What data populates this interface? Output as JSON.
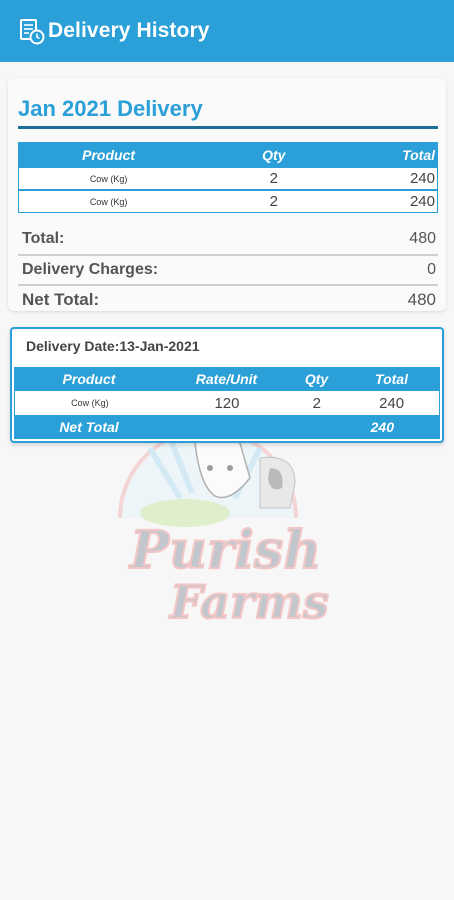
{
  "app_bar": {
    "title": "Delivery History",
    "icon": "delivery-clock-icon"
  },
  "colors": {
    "primary": "#2b9fd8",
    "accent_line": "#1e6f96"
  },
  "monthly_summary": {
    "title": "Jan 2021 Delivery",
    "columns": [
      "Product",
      "Qty",
      "Total"
    ],
    "rows": [
      {
        "product": "Cow (Kg)",
        "qty": "2",
        "total": "240"
      },
      {
        "product": "Cow (Kg)",
        "qty": "2",
        "total": "240"
      }
    ],
    "total_label": "Total:",
    "total_value": "480",
    "charges_label": "Delivery Charges:",
    "charges_value": "0",
    "net_label": "Net Total:",
    "net_value": "480"
  },
  "delivery": {
    "date_label": "Delivery Date:13-Jan-2021",
    "columns": [
      "Product",
      "Rate/Unit",
      "Qty",
      "Total"
    ],
    "rows": [
      {
        "product": "Cow (Kg)",
        "rate": "120",
        "qty": "2",
        "total": "240"
      }
    ],
    "net_label": "Net Total",
    "net_value": "240"
  },
  "watermark": {
    "line1": "Purish",
    "line2": "Farms"
  }
}
